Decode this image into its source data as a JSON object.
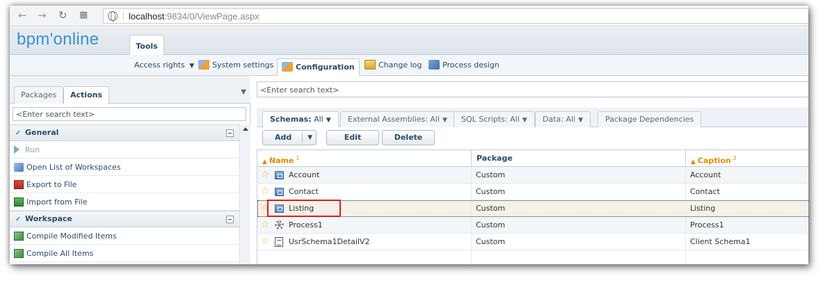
{
  "browser": {
    "url_host": "localhost",
    "url_path": ":9834/0/ViewPage.aspx"
  },
  "app": {
    "logo": "bpm'online",
    "main_tab": "Tools"
  },
  "toolbar": {
    "items": [
      {
        "label": "Access rights",
        "has_menu": true
      },
      {
        "label": "System settings"
      },
      {
        "label": "Configuration",
        "active": true
      },
      {
        "label": "Change log"
      },
      {
        "label": "Process design"
      }
    ]
  },
  "left_panel": {
    "tabs": [
      "Packages",
      "Actions"
    ],
    "active_tab": "Actions",
    "search_placeholder": "<Enter search text>",
    "groups": [
      {
        "title": "General",
        "items": [
          {
            "label": "Run",
            "disabled": true,
            "icon": "run-icon"
          },
          {
            "label": "Open List of Workspaces",
            "icon": "workspaces-icon"
          },
          {
            "label": "Export to File",
            "icon": "export-icon"
          },
          {
            "label": "Import from File",
            "icon": "import-icon"
          }
        ]
      },
      {
        "title": "Workspace",
        "items": [
          {
            "label": "Compile Modified Items",
            "icon": "compile-icon"
          },
          {
            "label": "Compile All Items",
            "icon": "compile-icon"
          }
        ]
      }
    ]
  },
  "right_panel": {
    "search_placeholder": "<Enter search text>",
    "tabs": [
      {
        "label": "Schemas:",
        "filter": "All",
        "active": true
      },
      {
        "label": "External Assemblies:",
        "filter": "All"
      },
      {
        "label": "SQL Scripts:",
        "filter": "All"
      },
      {
        "label": "Data:",
        "filter": "All"
      },
      {
        "label": "Package Dependencies"
      }
    ],
    "buttons": {
      "add": "Add",
      "edit": "Edit",
      "delete": "Delete"
    },
    "grid": {
      "columns": [
        {
          "label": "Name",
          "sort_index": "1",
          "sorted": true
        },
        {
          "label": "Package",
          "sorted": false
        },
        {
          "label": "Caption",
          "sort_index": "2",
          "sorted": true
        }
      ],
      "rows": [
        {
          "name": "Account",
          "package": "Custom",
          "caption": "Account",
          "icon": "object-icon"
        },
        {
          "name": "Contact",
          "package": "Custom",
          "caption": "Contact",
          "icon": "object-icon"
        },
        {
          "name": "Listing",
          "package": "Custom",
          "caption": "Listing",
          "icon": "object-icon",
          "selected": true
        },
        {
          "name": "Process1",
          "package": "Custom",
          "caption": "Process1",
          "icon": "process-icon"
        },
        {
          "name": "UsrSchema1DetailV2",
          "package": "Custom",
          "caption": "Client Schema1",
          "icon": "client-schema-icon"
        }
      ]
    }
  },
  "colors": {
    "accent": "#3a8fd1",
    "sort": "#e08a00",
    "highlight": "#d92020"
  }
}
